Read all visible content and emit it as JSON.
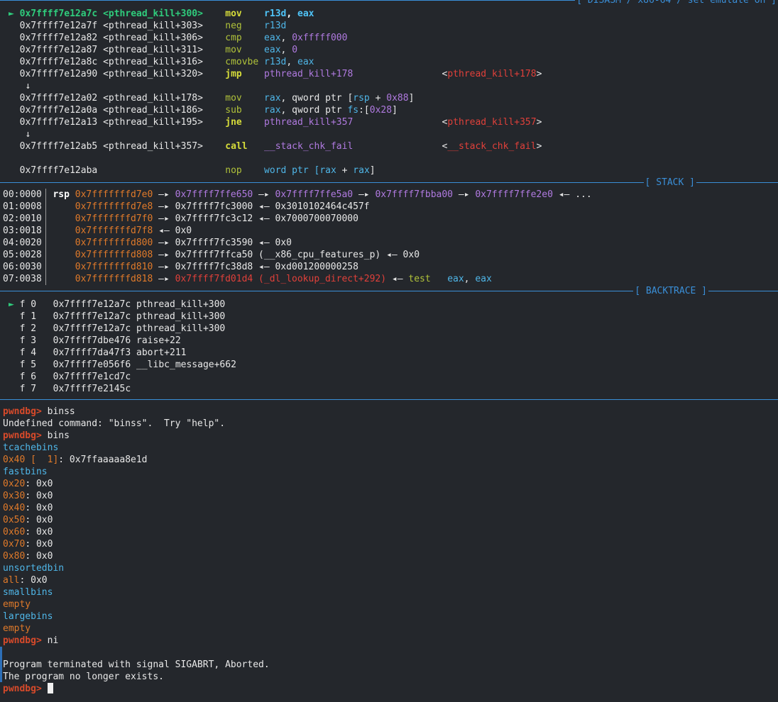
{
  "headers": {
    "disasm": "[ DISASM / x86-64 / set emulate on ]",
    "stack": "[ STACK ]",
    "backtrace": "[ BACKTRACE ]"
  },
  "disasm": [
    {
      "marker": "►",
      "addr": "0x7ffff7e12a7c",
      "sym": "<pthread_kill+300>",
      "mn": "mov",
      "ops": [
        [
          "r13d",
          "bcyan"
        ],
        [
          ", ",
          "bwhite"
        ],
        [
          "eax",
          "bcyan"
        ]
      ],
      "ann": null,
      "current": true
    },
    {
      "marker": "",
      "addr": "0x7ffff7e12a7f",
      "sym": "<pthread_kill+303>",
      "mn": "neg",
      "ops": [
        [
          "r13d",
          "cyan"
        ]
      ],
      "ann": null
    },
    {
      "marker": "",
      "addr": "0x7ffff7e12a82",
      "sym": "<pthread_kill+306>",
      "mn": "cmp",
      "ops": [
        [
          "eax",
          "cyan"
        ],
        [
          ", ",
          "white"
        ],
        [
          "0xfffff000",
          "purple"
        ]
      ],
      "ann": null
    },
    {
      "marker": "",
      "addr": "0x7ffff7e12a87",
      "sym": "<pthread_kill+311>",
      "mn": "mov",
      "ops": [
        [
          "eax",
          "cyan"
        ],
        [
          ", ",
          "white"
        ],
        [
          "0",
          "purple"
        ]
      ],
      "ann": null
    },
    {
      "marker": "",
      "addr": "0x7ffff7e12a8c",
      "sym": "<pthread_kill+316>",
      "mn": "cmovbe",
      "ops": [
        [
          "r13d",
          "cyan"
        ],
        [
          ", ",
          "white"
        ],
        [
          "eax",
          "cyan"
        ]
      ],
      "ann": null
    },
    {
      "marker": "",
      "addr": "0x7ffff7e12a90",
      "sym": "<pthread_kill+320>",
      "mn": "jmp",
      "bold": true,
      "ops": [
        [
          "pthread_kill+178",
          "purple"
        ]
      ],
      "ann": "pthread_kill+178"
    },
    {
      "arrow": "↓"
    },
    {
      "marker": "",
      "addr": "0x7ffff7e12a02",
      "sym": "<pthread_kill+178>",
      "mn": "mov",
      "ops": [
        [
          "rax",
          "cyan"
        ],
        [
          ", qword ptr [",
          "white"
        ],
        [
          "rsp",
          "cyan"
        ],
        [
          " + ",
          "white"
        ],
        [
          "0x88",
          "purple"
        ],
        [
          "]",
          "white"
        ]
      ],
      "ann": null
    },
    {
      "marker": "",
      "addr": "0x7ffff7e12a0a",
      "sym": "<pthread_kill+186>",
      "mn": "sub",
      "ops": [
        [
          "rax",
          "cyan"
        ],
        [
          ", qword ptr ",
          "white"
        ],
        [
          "fs",
          "cyan"
        ],
        [
          ":[",
          "white"
        ],
        [
          "0x28",
          "purple"
        ],
        [
          "]",
          "white"
        ]
      ],
      "ann": null
    },
    {
      "marker": "",
      "addr": "0x7ffff7e12a13",
      "sym": "<pthread_kill+195>",
      "mn": "jne",
      "bold": true,
      "ops": [
        [
          "pthread_kill+357",
          "purple"
        ]
      ],
      "ann": "pthread_kill+357"
    },
    {
      "arrow": "↓"
    },
    {
      "marker": "",
      "addr": "0x7ffff7e12ab5",
      "sym": "<pthread_kill+357>",
      "mn": "call",
      "bold": true,
      "ops": [
        [
          "__stack_chk_fail",
          "purple"
        ]
      ],
      "ann": "__stack_chk_fail"
    },
    {
      "blank": true
    },
    {
      "marker": "",
      "addr": "0x7ffff7e12aba",
      "sym": "",
      "mn": "nop",
      "ops": [
        [
          "word ptr [",
          "cyan"
        ],
        [
          "rax",
          "cyan"
        ],
        [
          " + ",
          "white"
        ],
        [
          "rax",
          "cyan"
        ],
        [
          "]",
          "white"
        ]
      ],
      "ann": null
    }
  ],
  "stack": [
    {
      "idx": "00:0000",
      "reg": "rsp",
      "chain": [
        [
          "0x7fffffffd7e0",
          "orange"
        ],
        [
          " —▸ ",
          "white"
        ],
        [
          "0x7ffff7ffe650",
          "purple"
        ],
        [
          " —▸ ",
          "white"
        ],
        [
          "0x7ffff7ffe5a0",
          "purple"
        ],
        [
          " —▸ ",
          "white"
        ],
        [
          "0x7ffff7fbba00",
          "purple"
        ],
        [
          " —▸ ",
          "white"
        ],
        [
          "0x7ffff7ffe2e0",
          "purple"
        ],
        [
          " ◂— ...",
          "white"
        ]
      ]
    },
    {
      "idx": "01:0008",
      "reg": "",
      "chain": [
        [
          "0x7fffffffd7e8",
          "orange"
        ],
        [
          " —▸ 0x7ffff7fc3000 ◂— 0x3010102464c457f",
          "white"
        ]
      ]
    },
    {
      "idx": "02:0010",
      "reg": "",
      "chain": [
        [
          "0x7fffffffd7f0",
          "orange"
        ],
        [
          " —▸ 0x7ffff7fc3c12 ◂— 0x7000700070000",
          "white"
        ]
      ]
    },
    {
      "idx": "03:0018",
      "reg": "",
      "chain": [
        [
          "0x7fffffffd7f8",
          "orange"
        ],
        [
          " ◂— 0x0",
          "white"
        ]
      ]
    },
    {
      "idx": "04:0020",
      "reg": "",
      "chain": [
        [
          "0x7fffffffd800",
          "orange"
        ],
        [
          " —▸ 0x7ffff7fc3590 ◂— 0x0",
          "white"
        ]
      ]
    },
    {
      "idx": "05:0028",
      "reg": "",
      "chain": [
        [
          "0x7fffffffd808",
          "orange"
        ],
        [
          " —▸ 0x7ffff7ffca50 (__x86_cpu_features_p) ◂— 0x0",
          "white"
        ]
      ]
    },
    {
      "idx": "06:0030",
      "reg": "",
      "chain": [
        [
          "0x7fffffffd810",
          "orange"
        ],
        [
          " —▸ 0x7ffff7fc38d8 ◂— 0xd001200000258",
          "white"
        ]
      ]
    },
    {
      "idx": "07:0038",
      "reg": "",
      "chain": [
        [
          "0x7fffffffd818",
          "orange"
        ],
        [
          " —▸ ",
          "white"
        ],
        [
          "0x7ffff7fd01d4 (_dl_lookup_direct+292)",
          "red"
        ],
        [
          " ◂— ",
          "white"
        ],
        [
          "test",
          "yellow"
        ],
        [
          "   ",
          "white"
        ],
        [
          "eax",
          "cyan"
        ],
        [
          ", ",
          "white"
        ],
        [
          "eax",
          "cyan"
        ]
      ]
    }
  ],
  "backtrace": [
    {
      "marker": "►",
      "frame": "f 0",
      "addr": "0x7ffff7e12a7c",
      "sym": "pthread_kill+300"
    },
    {
      "marker": "",
      "frame": "f 1",
      "addr": "0x7ffff7e12a7c",
      "sym": "pthread_kill+300"
    },
    {
      "marker": "",
      "frame": "f 2",
      "addr": "0x7ffff7e12a7c",
      "sym": "pthread_kill+300"
    },
    {
      "marker": "",
      "frame": "f 3",
      "addr": "0x7ffff7dbe476",
      "sym": "raise+22"
    },
    {
      "marker": "",
      "frame": "f 4",
      "addr": "0x7ffff7da47f3",
      "sym": "abort+211"
    },
    {
      "marker": "",
      "frame": "f 5",
      "addr": "0x7ffff7e056f6",
      "sym": "__libc_message+662"
    },
    {
      "marker": "",
      "frame": "f 6",
      "addr": "0x7ffff7e1cd7c",
      "sym": ""
    },
    {
      "marker": "",
      "frame": "f 7",
      "addr": "0x7ffff7e2145c",
      "sym": ""
    }
  ],
  "console": [
    [
      [
        "pwndbg> ",
        "brred"
      ],
      [
        "binss",
        "white"
      ]
    ],
    [
      [
        "Undefined command: \"binss\".  Try \"help\".",
        "white"
      ]
    ],
    [
      [
        "pwndbg> ",
        "brred"
      ],
      [
        "bins",
        "white"
      ]
    ],
    [
      [
        "tcachebins",
        "cyan"
      ]
    ],
    [
      [
        "0x40 [  1]",
        "orange"
      ],
      [
        ": 0x7ffaaaaa8e1d",
        "white"
      ]
    ],
    [
      [
        "fastbins",
        "cyan"
      ]
    ],
    [
      [
        "0x20",
        "orange"
      ],
      [
        ": 0x0",
        "white"
      ]
    ],
    [
      [
        "0x30",
        "orange"
      ],
      [
        ": 0x0",
        "white"
      ]
    ],
    [
      [
        "0x40",
        "orange"
      ],
      [
        ": 0x0",
        "white"
      ]
    ],
    [
      [
        "0x50",
        "orange"
      ],
      [
        ": 0x0",
        "white"
      ]
    ],
    [
      [
        "0x60",
        "orange"
      ],
      [
        ": 0x0",
        "white"
      ]
    ],
    [
      [
        "0x70",
        "orange"
      ],
      [
        ": 0x0",
        "white"
      ]
    ],
    [
      [
        "0x80",
        "orange"
      ],
      [
        ": 0x0",
        "white"
      ]
    ],
    [
      [
        "unsortedbin",
        "cyan"
      ]
    ],
    [
      [
        "all",
        "orange"
      ],
      [
        ": 0x0",
        "white"
      ]
    ],
    [
      [
        "smallbins",
        "cyan"
      ]
    ],
    [
      [
        "empty",
        "orange"
      ]
    ],
    [
      [
        "largebins",
        "cyan"
      ]
    ],
    [
      [
        "empty",
        "orange"
      ]
    ],
    [
      [
        "pwndbg> ",
        "brred"
      ],
      [
        "ni",
        "white"
      ]
    ],
    [
      [
        "",
        "white"
      ]
    ],
    [
      [
        "Program terminated with signal SIGABRT, Aborted.",
        "white"
      ]
    ],
    [
      [
        "The program no longer exists.",
        "white"
      ]
    ],
    [
      [
        "pwndbg> ",
        "brred"
      ]
    ]
  ]
}
